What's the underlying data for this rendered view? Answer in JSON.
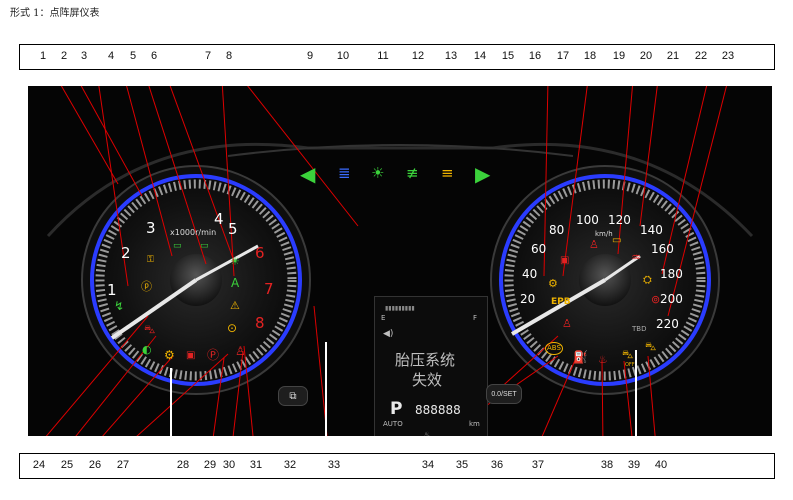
{
  "heading": "形式 1：点阵屏仪表",
  "top_numbers": [
    "1",
    "2",
    "3",
    "4",
    "5",
    "6",
    "7",
    "8",
    "9",
    "10",
    "11",
    "12",
    "13",
    "14",
    "15",
    "16",
    "17",
    "18",
    "19",
    "20",
    "21",
    "22",
    "23"
  ],
  "bottom_numbers": [
    "24",
    "25",
    "26",
    "27",
    "28",
    "29",
    "30",
    "31",
    "32",
    "33",
    "34",
    "35",
    "36",
    "37",
    "38",
    "39",
    "40"
  ],
  "tachometer": {
    "scale_labels": [
      "1",
      "2",
      "3",
      "4",
      "5",
      "6",
      "7",
      "8"
    ],
    "unit": "x1000r/min"
  },
  "speedometer": {
    "scale_labels": [
      "20",
      "40",
      "60",
      "80",
      "100",
      "120",
      "140",
      "160",
      "180",
      "200",
      "220"
    ],
    "unit": "km/h",
    "tbd_label": "TBD",
    "epb_label": "EPB"
  },
  "center_screen": {
    "fuel_empty": "E",
    "fuel_full": "F",
    "message_line1": "胎压系统",
    "message_line2": "失效",
    "gear": "P",
    "odometer": "888888",
    "drive_mode": "AUTO",
    "odometer_unit": "km",
    "temp_cold": "C",
    "temp_hot": "H"
  },
  "indicators": {
    "auto_hold": "A",
    "abs": "ABS",
    "off_label": "OFF"
  },
  "buttons": {
    "reset_label": "0.0/SET"
  },
  "colors": {
    "green": "#3bd23b",
    "red": "#e32222",
    "amber": "#f0b400",
    "blue": "#3a6bff",
    "ring_blue": "#2a3cff"
  }
}
